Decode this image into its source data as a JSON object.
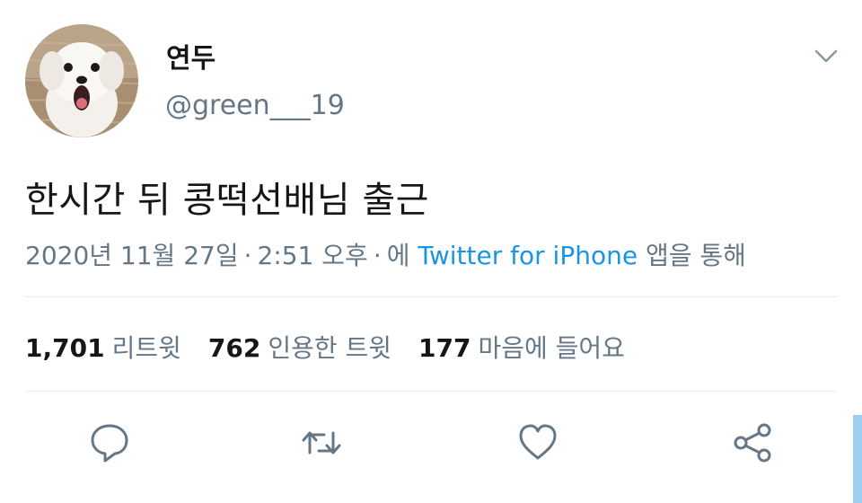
{
  "user": {
    "display_name": "연두",
    "handle": "@green___19",
    "avatar": "white-puppy-avatar"
  },
  "tweet": {
    "text": "한시간 뒤 콩떡선배님 출근",
    "date": "2020년 11월 27일",
    "time": "2:51 오후",
    "source_prefix": "에",
    "source": "Twitter for iPhone",
    "source_suffix": "앱을 통해"
  },
  "stats": [
    {
      "count": "1,701",
      "label": "리트윗"
    },
    {
      "count": "762",
      "label": "인용한 트윗"
    },
    {
      "count": "177",
      "label": "마음에 들어요"
    }
  ],
  "actions": {
    "reply_icon": "reply-icon",
    "retweet_icon": "retweet-icon",
    "like_icon": "heart-icon",
    "share_icon": "share-icon",
    "menu_icon": "chevron-down-icon"
  },
  "colors": {
    "text": "#14171a",
    "secondary": "#657786",
    "link": "#1b95e0",
    "divider": "#e6ecf0",
    "icon": "#657786"
  }
}
